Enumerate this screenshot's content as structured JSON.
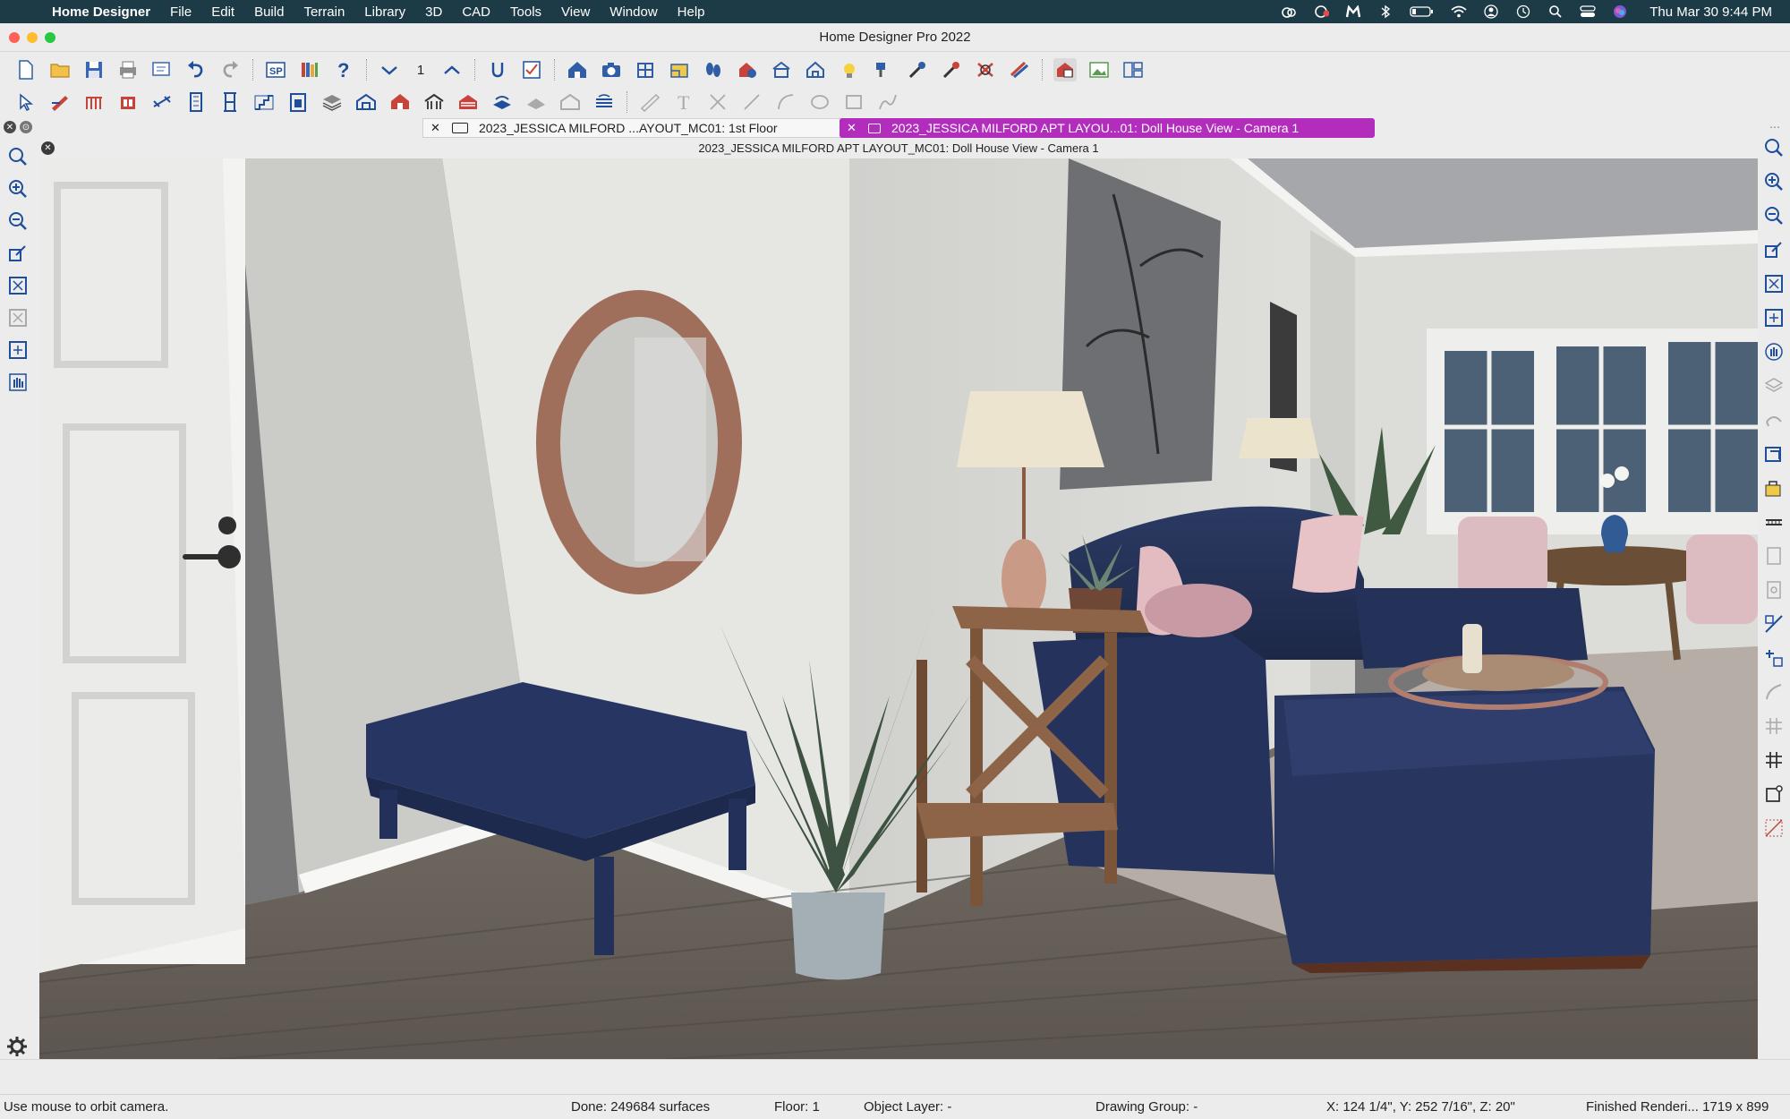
{
  "menubar": {
    "app_name": "Home Designer",
    "items": [
      "File",
      "Edit",
      "Build",
      "Terrain",
      "Library",
      "3D",
      "CAD",
      "Tools",
      "View",
      "Window",
      "Help"
    ],
    "clock": "Thu Mar 30  9:44 PM"
  },
  "window": {
    "title": "Home Designer Pro 2022"
  },
  "toolbar": {
    "floor_number": "1"
  },
  "tabs": [
    {
      "label": "2023_JESSICA MILFORD ...AYOUT_MC01: 1st Floor",
      "active": false
    },
    {
      "label": "2023_JESSICA MILFORD APT LAYOU...01: Doll House View - Camera 1",
      "active": true,
      "color": "#b32dbd"
    }
  ],
  "view": {
    "title": "2023_JESSICA MILFORD APT LAYOUT_MC01: Doll House View - Camera 1"
  },
  "status": {
    "hint": "Use mouse to orbit camera.",
    "done": "Done:  249684 surfaces",
    "floor": "Floor: 1",
    "object_layer": "Object Layer: -",
    "drawing_group": "Drawing Group: -",
    "coordinates": "X: 124 1/4\", Y: 252 7/16\", Z: 20\"",
    "render_status": "Finished Renderi...  1719 x 899"
  },
  "colors": {
    "menubar_bg": "#1d3b47",
    "active_tab": "#b32dbd",
    "sofa_navy": "#243257",
    "cushion_pink": "#e7c3c8"
  }
}
